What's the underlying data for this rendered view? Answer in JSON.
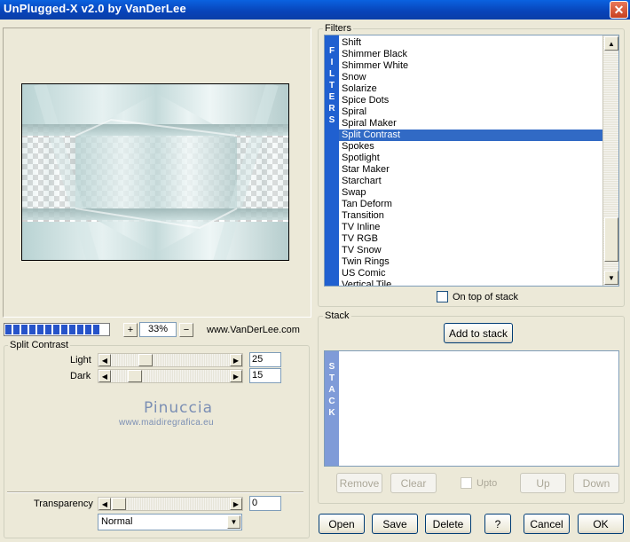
{
  "window": {
    "title": "UnPlugged-X v2.0 by VanDerLee",
    "close_label": "✕"
  },
  "preview": {
    "progress_segments": 12,
    "zoom_minus": "−",
    "zoom_plus": "+",
    "zoom": "33%",
    "url": "www.VanDerLee.com"
  },
  "params": {
    "group_title": "Split Contrast",
    "light": {
      "label": "Light",
      "value": "25"
    },
    "dark": {
      "label": "Dark",
      "value": "15"
    },
    "transparency": {
      "label": "Transparency",
      "value": "0"
    },
    "blend_mode": "Normal"
  },
  "watermark": {
    "name": "Pinuccia",
    "site": "www.maidiregrafica.eu"
  },
  "filters": {
    "group_title": "Filters",
    "strip_letters": [
      "F",
      "I",
      "L",
      "T",
      "E",
      "R",
      "S"
    ],
    "items": [
      "Shift",
      "Shimmer Black",
      "Shimmer White",
      "Snow",
      "Solarize",
      "Spice Dots",
      "Spiral",
      "Spiral Maker",
      "Split Contrast",
      "Spokes",
      "Spotlight",
      "Star Maker",
      "Starchart",
      "Swap",
      "Tan Deform",
      "Transition",
      "TV Inline",
      "TV RGB",
      "TV Snow",
      "Twin Rings",
      "US Comic",
      "Vertical Tile"
    ],
    "selected": "Split Contrast",
    "on_top_label": "On top of stack",
    "on_top_checked": false
  },
  "stack": {
    "group_title": "Stack",
    "add_label": "Add to stack",
    "strip_letters": [
      "S",
      "T",
      "A",
      "C",
      "K"
    ],
    "remove_label": "Remove",
    "clear_label": "Clear",
    "upto_label": "Upto",
    "up_label": "Up",
    "down_label": "Down"
  },
  "footer": {
    "open_label": "Open",
    "save_label": "Save",
    "delete_label": "Delete",
    "help_label": "?",
    "cancel_label": "Cancel",
    "ok_label": "OK"
  },
  "icons": {
    "left_arrow": "◀",
    "right_arrow": "▶",
    "up_arrow": "▲",
    "down_arrow": "▼"
  },
  "colors": {
    "titlebar": "#0843b8",
    "selection": "#316ac5",
    "strip": "#2060d0",
    "stack_strip": "#7f9bd8"
  }
}
